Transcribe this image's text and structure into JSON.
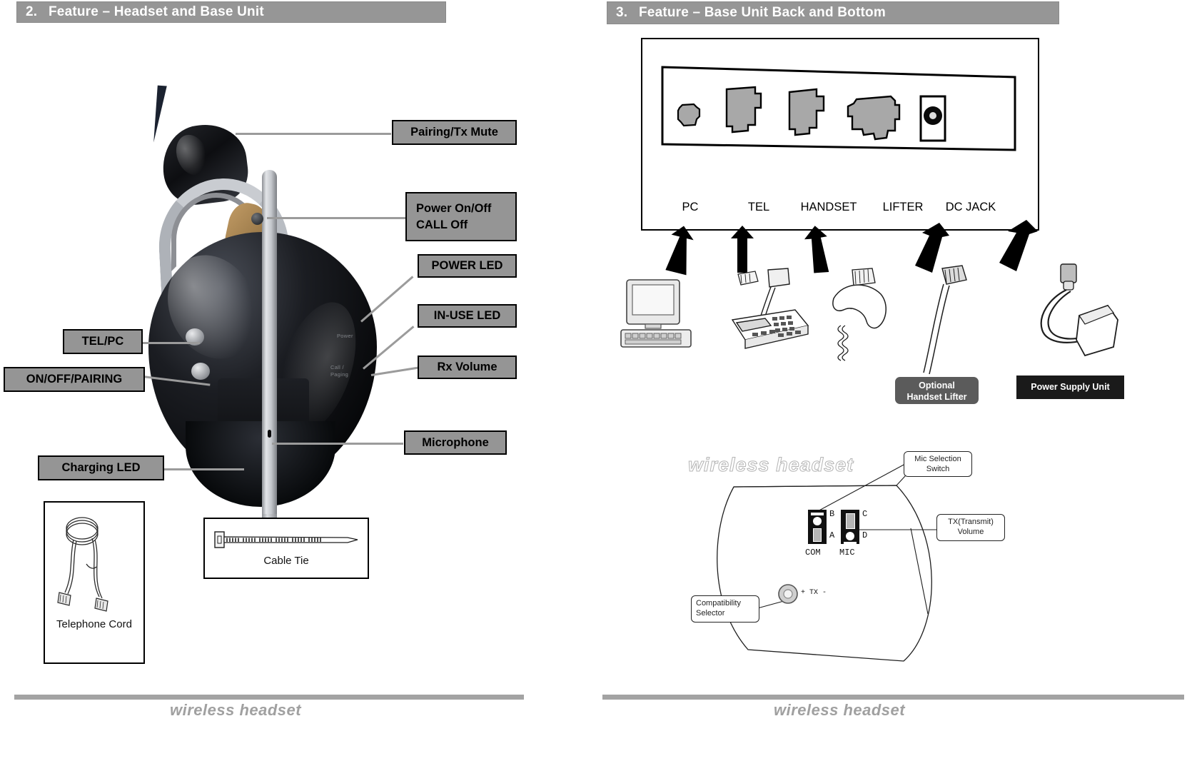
{
  "document": {
    "pages": [
      {
        "number": "2.",
        "title": "Feature – Headset and Base Unit",
        "footer": "wireless headset",
        "callouts": [
          {
            "id": "pairing-tx-mute",
            "label": "Pairing/Tx Mute"
          },
          {
            "id": "power-on-off",
            "line1": "Power On/Off",
            "line2": "CALL Off"
          },
          {
            "id": "power-led",
            "label": "POWER LED"
          },
          {
            "id": "in-use-led",
            "label": "IN-USE LED"
          },
          {
            "id": "rx-volume",
            "label": "Rx Volume"
          },
          {
            "id": "microphone",
            "label": "Microphone"
          },
          {
            "id": "tel-pc",
            "label": "TEL/PC"
          },
          {
            "id": "on-off-pairing",
            "label": "ON/OFF/PAIRING"
          },
          {
            "id": "charging-led",
            "label": "Charging LED"
          }
        ],
        "photo_legends": [
          "Power",
          "Call /",
          "Paging"
        ],
        "accessories": [
          {
            "id": "telephone-cord",
            "caption": "Telephone Cord"
          },
          {
            "id": "cable-tie",
            "caption": "Cable Tie"
          }
        ]
      },
      {
        "number": "3.",
        "title": "Feature – Base Unit Back and Bottom",
        "footer": "wireless headset",
        "ports": [
          {
            "id": "pc",
            "label": "PC"
          },
          {
            "id": "tel",
            "label": "TEL"
          },
          {
            "id": "handset",
            "label": "HANDSET"
          },
          {
            "id": "lifter",
            "label": "LIFTER"
          },
          {
            "id": "dc-jack",
            "label": "DC JACK"
          }
        ],
        "devices": [
          {
            "id": "computer",
            "label": ""
          },
          {
            "id": "telephone",
            "label": ""
          },
          {
            "id": "handset",
            "label": ""
          },
          {
            "id": "handset-lifter",
            "line1": "Optional",
            "line2": "Handset Lifter"
          },
          {
            "id": "power-supply-unit",
            "line1": "Power Supply Unit",
            "line2": ""
          }
        ],
        "bottom_view": {
          "watermark": "wireless headset",
          "labels": [
            {
              "id": "mic-selection-switch",
              "line1": "Mic Selection",
              "line2": "Switch"
            },
            {
              "id": "tx-transmit-volume",
              "line1": "TX(Transmit)",
              "line2": "Volume"
            },
            {
              "id": "compatibility-selector",
              "line1": "Compatibility",
              "line2": "Selector"
            }
          ],
          "switch_marks": [
            "B",
            "A",
            "C",
            "D"
          ],
          "switch_names": [
            "COM",
            "MIC"
          ],
          "dial_label": "+ TX -"
        }
      }
    ]
  },
  "colors": {
    "title_bar_bg": "#969696",
    "callout_bg": "#959595",
    "leader_line": "#9b9b9b",
    "port_fill": "#a8a8a8",
    "footer_text": "#a0a0a0",
    "footer_bar": "#a3a3a3",
    "pill_bg": "#5b5b5b",
    "pill_dark_bg": "#1a1a1a"
  }
}
